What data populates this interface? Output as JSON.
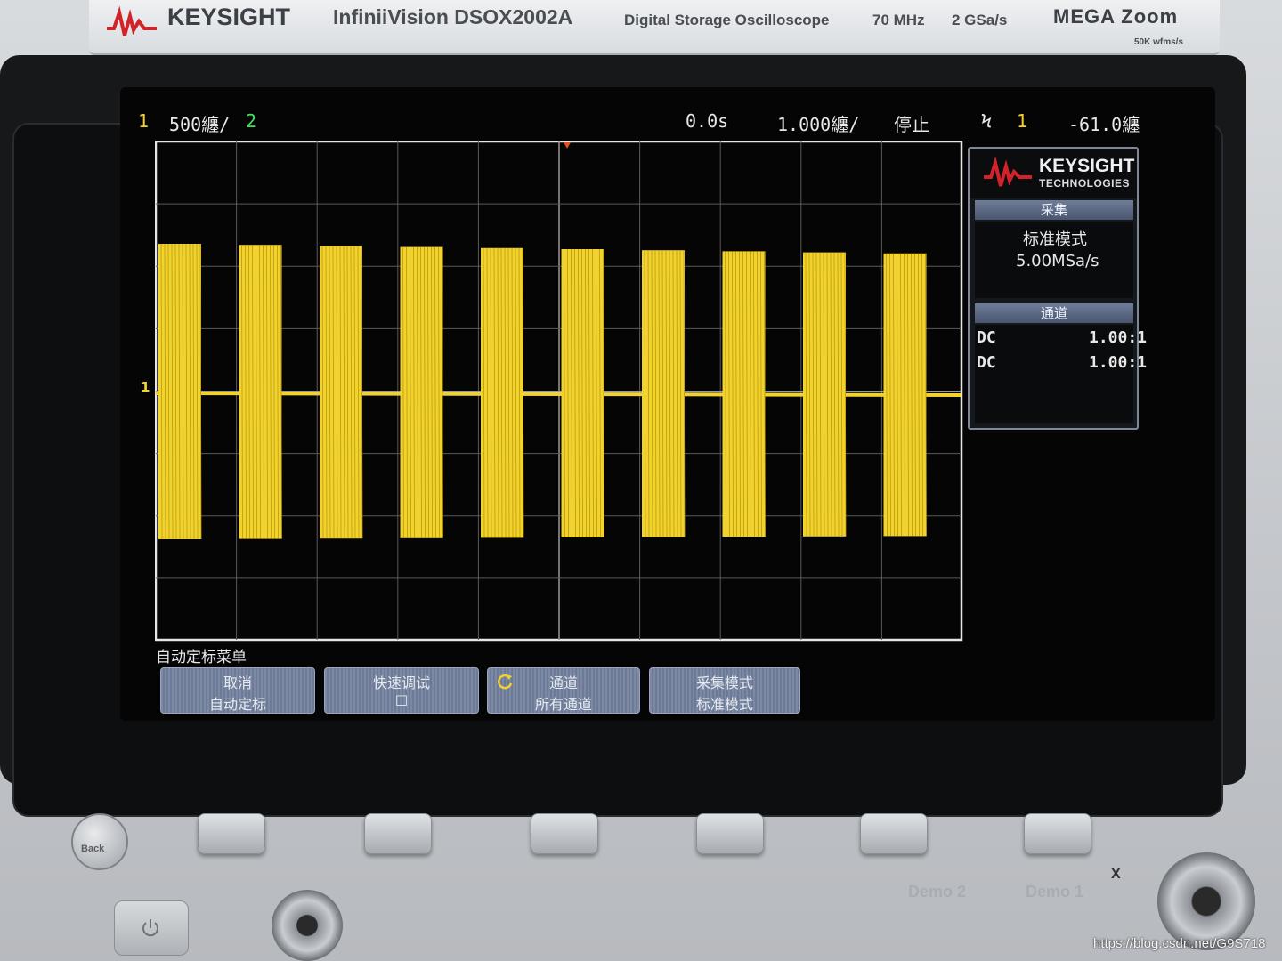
{
  "header": {
    "brand": "KEYSIGHT",
    "model": "InfiniiVision DSOX2002A",
    "description": "Digital Storage Oscilloscope",
    "bandwidth": "70 MHz",
    "sample_rate": "2 GSa/s",
    "megazoom": "MEGA Zoom",
    "megazoom_sub": "50K wfms/s"
  },
  "status_bar": {
    "ch1_label": "1",
    "ch1_scale": "500纏/",
    "ch2_label": "2",
    "time_offset": "0.0s",
    "time_scale": "1.000纏/",
    "run_state": "停止",
    "trigger_icon": "Ϟ",
    "trigger_channel": "1",
    "trigger_level": "-61.0纏"
  },
  "side_panel": {
    "logo_name": "KEYSIGHT",
    "logo_sub": "TECHNOLOGIES",
    "acq_header": "采集",
    "acq_mode": "标准模式",
    "acq_rate": "5.00MSa/s",
    "chan_header": "通道",
    "ch1_coupling": "DC",
    "ch1_probe": "1.00:1",
    "ch2_coupling": "DC",
    "ch2_probe": "1.00:1"
  },
  "softkey_menu": {
    "title": "自动定标菜单",
    "keys": [
      {
        "line1": "取消",
        "line2": "自动定标"
      },
      {
        "line1": "快速调试",
        "line2": "☐"
      },
      {
        "line1": "通道",
        "line2": "所有通道"
      },
      {
        "line1": "采集模式",
        "line2": "标准模式"
      }
    ]
  },
  "waveform": {
    "ch1_marker": "1",
    "burst_count": 10,
    "color": "#f2d22c"
  },
  "panel": {
    "back_label": "Back",
    "demo1_label": "Demo 1",
    "demo2_label": "Demo 2",
    "x_mark": "X"
  },
  "watermark": "https://blog.csdn.net/G9S718",
  "colors": {
    "ch1": "#f2d22c",
    "ch2": "#3fe55a",
    "softkey": "#7b89a4",
    "panel_border": "#7d8797"
  }
}
